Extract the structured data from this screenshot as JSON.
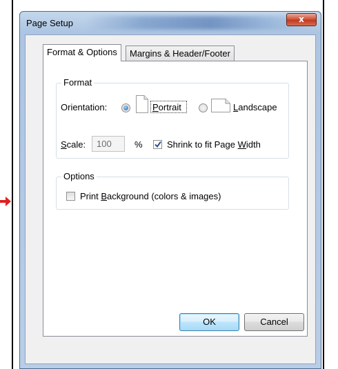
{
  "window": {
    "title": "Page Setup",
    "close_glyph": "x"
  },
  "tabs": [
    {
      "label": "Format & Options",
      "active": true
    },
    {
      "label": "Margins & Header/Footer",
      "active": false
    }
  ],
  "format_group": {
    "legend": "Format",
    "orientation_label": "Orientation:",
    "portrait": {
      "pre": "",
      "accel": "P",
      "post": "ortrait",
      "selected": true
    },
    "landscape": {
      "pre": "",
      "accel": "L",
      "post": "andscape",
      "selected": false
    },
    "scale_label": {
      "accel": "S",
      "post": "cale:"
    },
    "scale_value": "100",
    "percent": "%",
    "shrink": {
      "pre": "Shrink to fit Page ",
      "accel": "W",
      "post": "idth",
      "checked": true
    }
  },
  "options_group": {
    "legend": "Options",
    "print_bg": {
      "pre": "Print ",
      "accel": "B",
      "post": "ackground (colors & images)",
      "checked": false
    }
  },
  "buttons": {
    "ok": "OK",
    "cancel": "Cancel"
  },
  "colors": {
    "title_bar": "#b9cde6",
    "close_button": "#c94a2e",
    "radio_dot": "#1c5fa5"
  }
}
